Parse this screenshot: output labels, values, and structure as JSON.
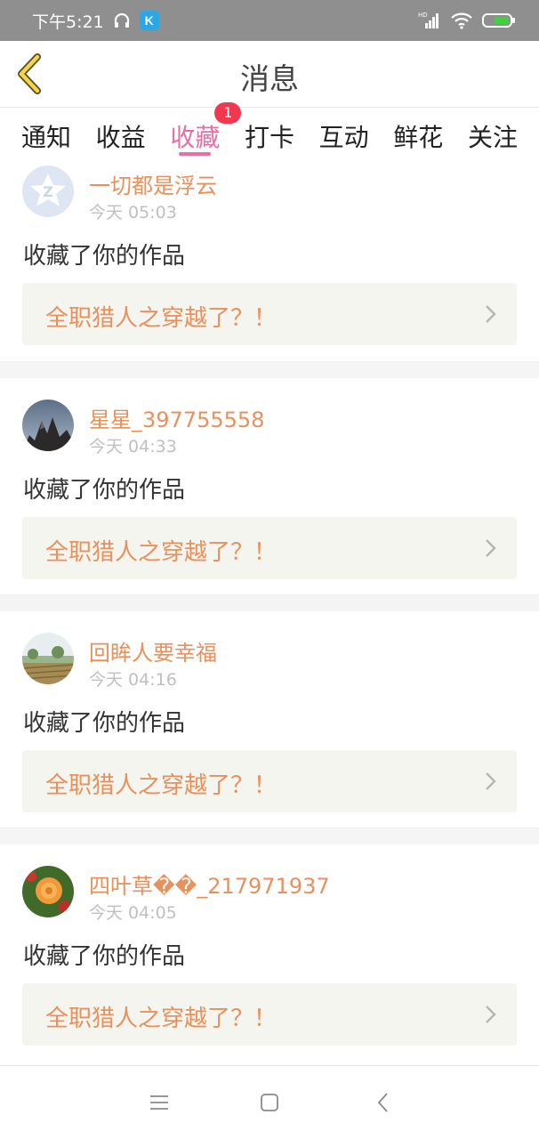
{
  "status_bar": {
    "time": "下午5:21",
    "app_icon_letter": "K",
    "network_label": "HD"
  },
  "header": {
    "title": "消息"
  },
  "tabs": [
    {
      "label": "通知"
    },
    {
      "label": "收益"
    },
    {
      "label": "收藏",
      "badge": "1",
      "active": true
    },
    {
      "label": "打卡"
    },
    {
      "label": "互动"
    },
    {
      "label": "鲜花"
    },
    {
      "label": "关注"
    }
  ],
  "messages": [
    {
      "username": "一切都是浮云",
      "time": "今天 05:03",
      "action": "收藏了你的作品",
      "work_title": "全职猎人之穿越了？！",
      "avatar": "default-avatar"
    },
    {
      "username": "星星_397755558",
      "time": "今天 04:33",
      "action": "收藏了你的作品",
      "work_title": "全职猎人之穿越了？！",
      "avatar": "mountain-photo"
    },
    {
      "username": "回眸人要幸福",
      "time": "今天 04:16",
      "action": "收藏了你的作品",
      "work_title": "全职猎人之穿越了？！",
      "avatar": "field-photo"
    },
    {
      "username": "四叶草��_217971937",
      "time": "今天 04:05",
      "action": "收藏了你的作品",
      "work_title": "全职猎人之穿越了？！",
      "avatar": "flower-photo"
    }
  ],
  "colors": {
    "accent_pink": "#e86fa6",
    "username_orange": "#e8915c",
    "badge_red": "#f2384e",
    "status_bar_gray": "#8f8f8f",
    "back_arrow_yellow": "#f5d547"
  },
  "navigation_bar": {
    "icons": [
      "menu-icon",
      "home-icon",
      "back-icon"
    ]
  }
}
